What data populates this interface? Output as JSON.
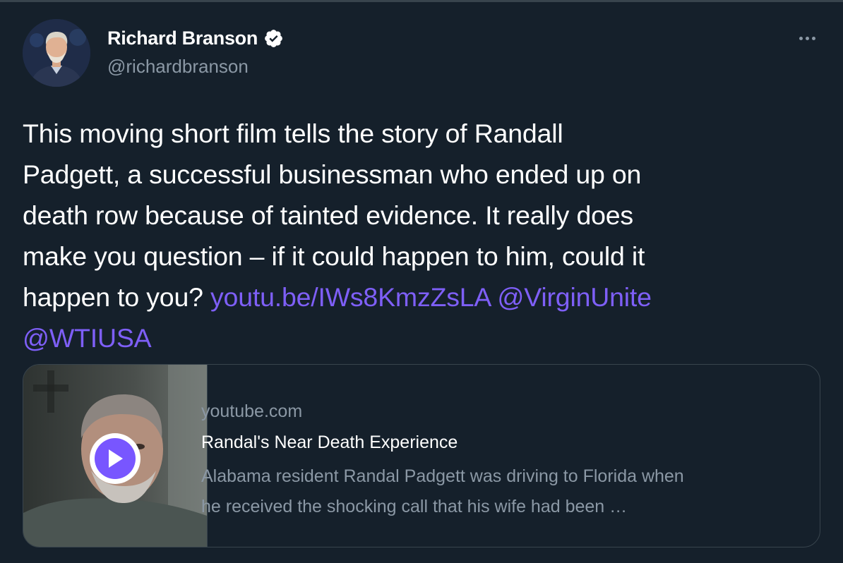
{
  "author": {
    "display_name": "Richard Branson",
    "handle": "@richardbranson",
    "verified": true,
    "avatar_icon": "user-avatar"
  },
  "menu": {
    "icon": "more-horizontal-icon"
  },
  "tweet": {
    "lines": [
      "This moving short film tells the story of Randall",
      "Padgett, a successful businessman who ended up on",
      "death row because of tainted evidence. It really does",
      "make you question – if it could happen to him, could it",
      "happen to you? "
    ],
    "links": {
      "url": "youtu.be/IWs8KmzZsLA",
      "mention_1": "@VirginUnite",
      "mention_2": "@WTIUSA"
    }
  },
  "card": {
    "domain": "youtube.com",
    "title": "Randal's Near Death Experience",
    "description_lines": [
      "Alabama resident Randal Padgett was driving to Florida when",
      "he received the shocking call that his wife had been …"
    ],
    "thumbnail_icon": "video-thumbnail",
    "play_icon": "play-icon"
  },
  "colors": {
    "background": "#15202b",
    "text": "#ffffff",
    "secondary_text": "#8b98a5",
    "link": "#7e5ff7",
    "border": "#38444d",
    "play_accent": "#7856ff"
  }
}
